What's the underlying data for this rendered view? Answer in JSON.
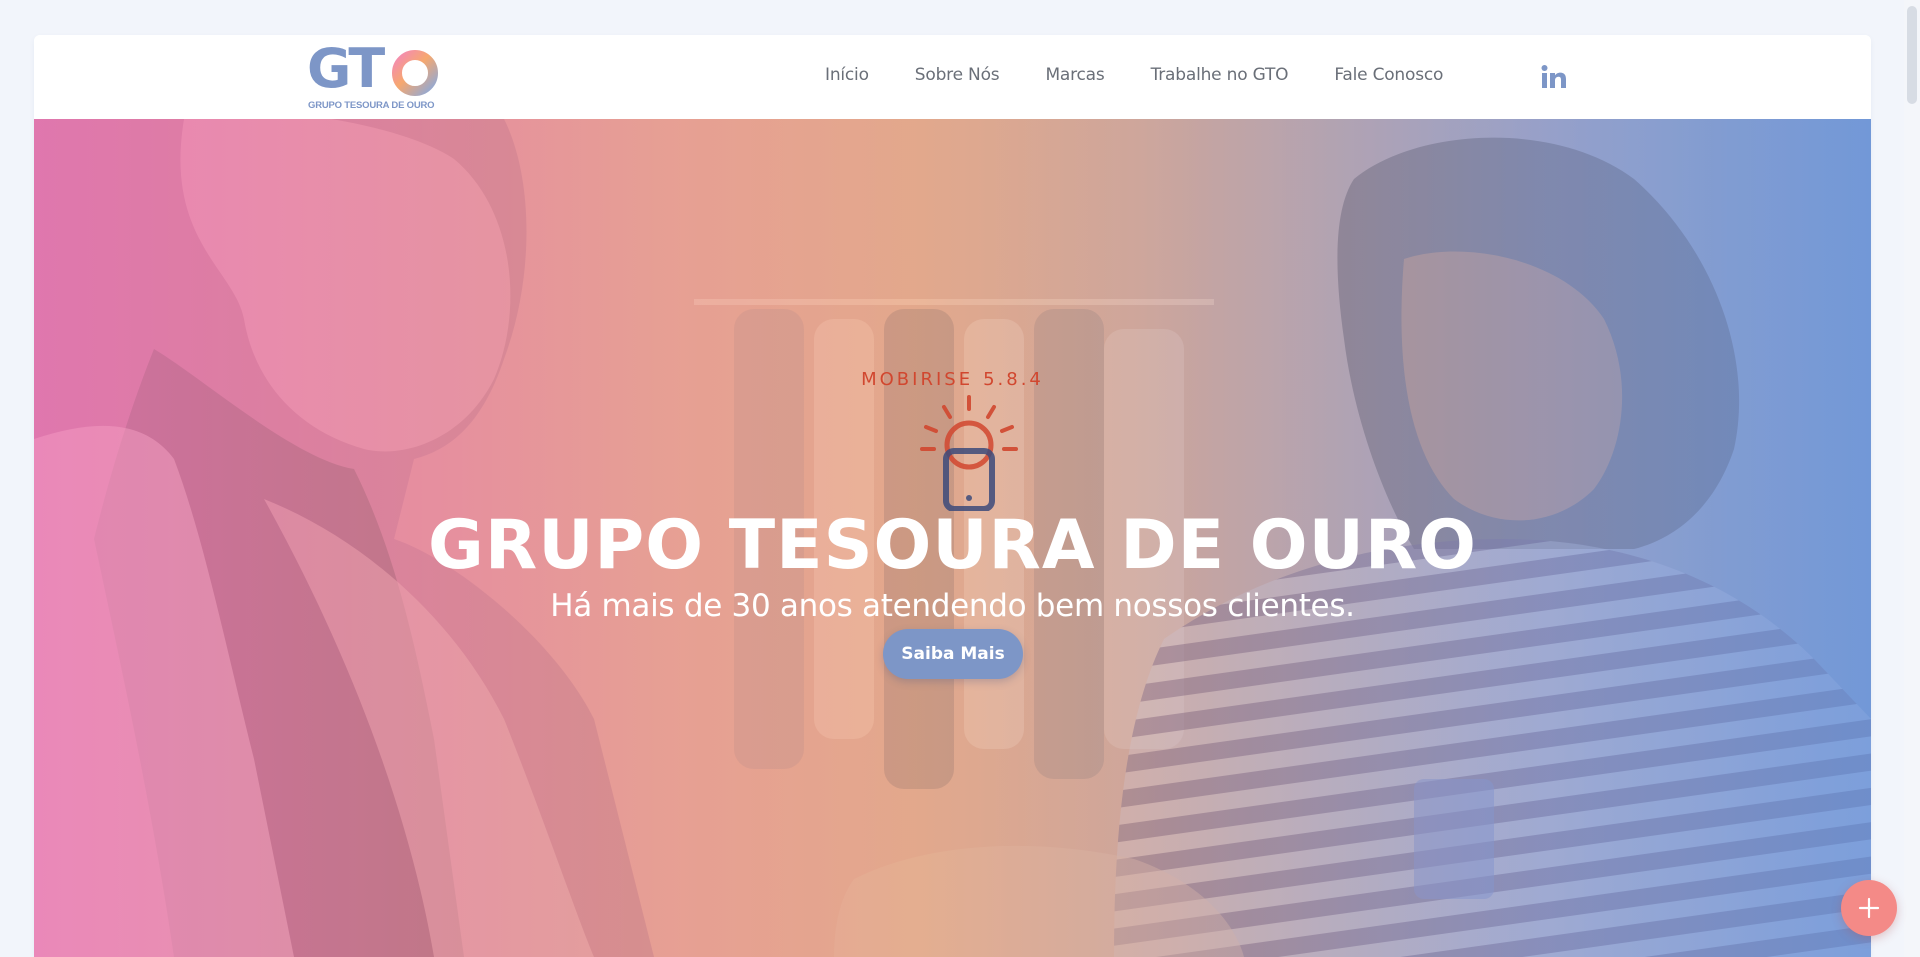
{
  "header": {
    "logo": {
      "letters": "GTO",
      "subtitle": "GRUPO TESOURA DE OURO"
    },
    "nav": [
      {
        "label": "Início"
      },
      {
        "label": "Sobre Nós"
      },
      {
        "label": "Marcas"
      },
      {
        "label": "Trabalhe no GTO"
      },
      {
        "label": "Fale Conosco"
      }
    ],
    "social_icon": "linkedin-icon"
  },
  "hero": {
    "kicker": "MOBIRISE",
    "version": "5.8.4",
    "badge_icon": "lightbulb-phone-icon",
    "title": "GRUPO TESOURA DE OURO",
    "subtitle": "Há mais de 30 anos atendendo bem nossos clientes.",
    "button_label": "Saiba Mais",
    "background_image": "two-women-in-clothing-store-photo"
  },
  "fab": {
    "icon": "plus-icon"
  },
  "colors": {
    "brand_blue": "#7d96c7",
    "kicker_red": "#d1472f",
    "fab_coral": "#f48a87",
    "nav_text": "#6a6f78",
    "page_bg": "#f2f5fb"
  }
}
